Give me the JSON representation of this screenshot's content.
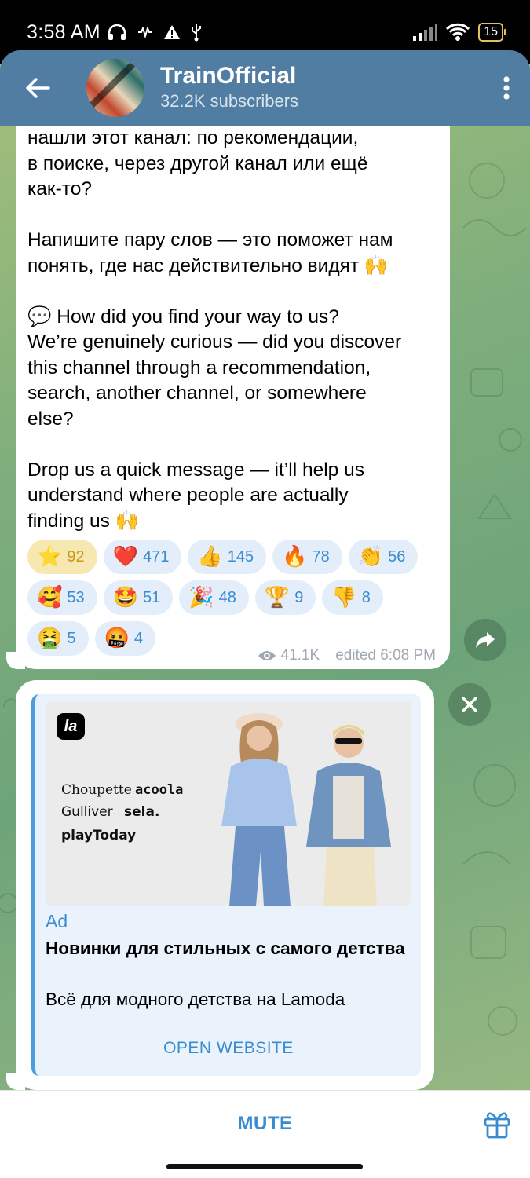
{
  "status_bar": {
    "time": "3:58 AM",
    "battery": "15",
    "icons": [
      "headphones-icon",
      "nfc-icon",
      "alert-icon",
      "usb-icon",
      "signal-icon",
      "wifi-icon",
      "battery-icon"
    ]
  },
  "header": {
    "channel_name": "TrainOfficial",
    "subscribers": "32.2K subscribers"
  },
  "message": {
    "text": "нашли этот канал: по рекомендации,\nв поиске, через другой канал или ещё\nкак-то?\n\nНапишите пару слов — это поможет нам\nпонять, где нас действительно видят 🙌\n\n💬 How did you find your way to us?\nWe’re genuinely curious — did you discover\nthis channel through a recommendation,\nsearch, another channel, or somewhere\nelse?\n\nDrop us a quick message — it’ll help us\nunderstand where people are actually\nfinding us 🙌",
    "reactions": [
      {
        "emoji": "⭐",
        "count": "92",
        "active": true
      },
      {
        "emoji": "❤️",
        "count": "471"
      },
      {
        "emoji": "👍",
        "count": "145"
      },
      {
        "emoji": "🔥",
        "count": "78"
      },
      {
        "emoji": "👏",
        "count": "56"
      },
      {
        "emoji": "🥰",
        "count": "53"
      },
      {
        "emoji": "🤩",
        "count": "51"
      },
      {
        "emoji": "🎉",
        "count": "48"
      },
      {
        "emoji": "🏆",
        "count": "9"
      },
      {
        "emoji": "👎",
        "count": "8"
      },
      {
        "emoji": "🤮",
        "count": "5"
      },
      {
        "emoji": "🤬",
        "count": "4"
      }
    ],
    "views": "41.1K",
    "edited": "edited 6:08 PM"
  },
  "ad": {
    "logo": "la",
    "brands": [
      "Choupette",
      "acoola",
      "Gulliver",
      "sela.",
      "playToday"
    ],
    "label": "Ad",
    "title": "Новинки для стильных с самого детства",
    "description": "Всё для модного детства на Lamoda",
    "button": "OPEN WEBSITE"
  },
  "bottom": {
    "mute": "MUTE"
  },
  "colors": {
    "header": "#517da2",
    "accent": "#3a8cd0",
    "active_reaction": "#f7e7b0"
  }
}
